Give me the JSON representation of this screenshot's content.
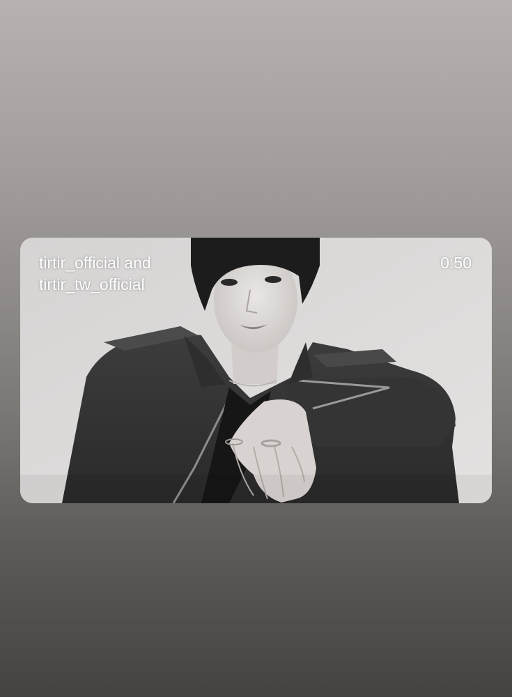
{
  "story": {
    "accounts_line1": "tirtir_official and",
    "accounts_line2": "tirtir_tw_official",
    "duration": "0:50"
  },
  "colors": {
    "background_top": "#b7b2b0",
    "background_bottom": "#454341",
    "overlay_text": "#ffffff"
  }
}
